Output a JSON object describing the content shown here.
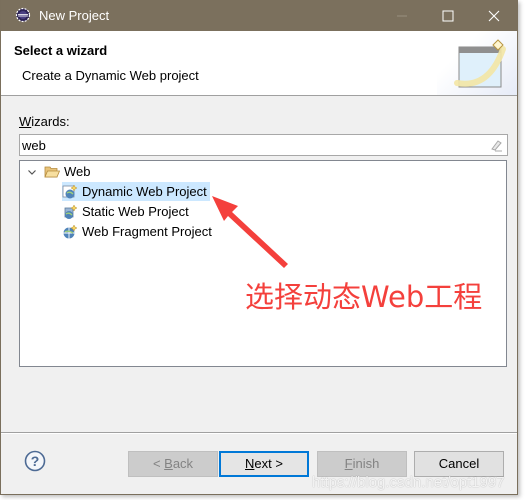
{
  "window": {
    "title": "New Project",
    "controls": {
      "minimize": "minimize-icon",
      "maximize": "maximize-icon",
      "close": "close-icon"
    }
  },
  "header": {
    "title": "Select a wizard",
    "description": "Create a Dynamic Web project",
    "banner_icon": "new-wizard-banner-icon"
  },
  "wizards": {
    "label_prefix": "W",
    "label_rest": "izards:",
    "filter_value": "web",
    "filter_clear_icon": "eraser-icon"
  },
  "tree": {
    "folder": {
      "label": "Web",
      "expanded": true,
      "icon": "folder-open-icon"
    },
    "items": [
      {
        "label": "Dynamic Web Project",
        "selected": true,
        "icon": "dynamic-web-project-icon"
      },
      {
        "label": "Static Web Project",
        "selected": false,
        "icon": "static-web-project-icon"
      },
      {
        "label": "Web Fragment Project",
        "selected": false,
        "icon": "web-fragment-project-icon"
      }
    ]
  },
  "annotation": {
    "text": "选择动态Web工程",
    "color": "#f4403c"
  },
  "buttons": {
    "back": {
      "pre": "< ",
      "mnemonic": "B",
      "rest": "ack",
      "enabled": false
    },
    "next": {
      "mnemonic": "N",
      "rest": "ext >",
      "enabled": true,
      "default": true
    },
    "finish": {
      "mnemonic": "F",
      "rest": "inish",
      "enabled": false
    },
    "cancel": {
      "label": "Cancel",
      "enabled": true
    }
  },
  "watermark": "https://blog.csdn.net/opt1997",
  "colors": {
    "titlebar": "#7b705d",
    "selection": "#cce8ff",
    "default_button_border": "#0078d7"
  }
}
